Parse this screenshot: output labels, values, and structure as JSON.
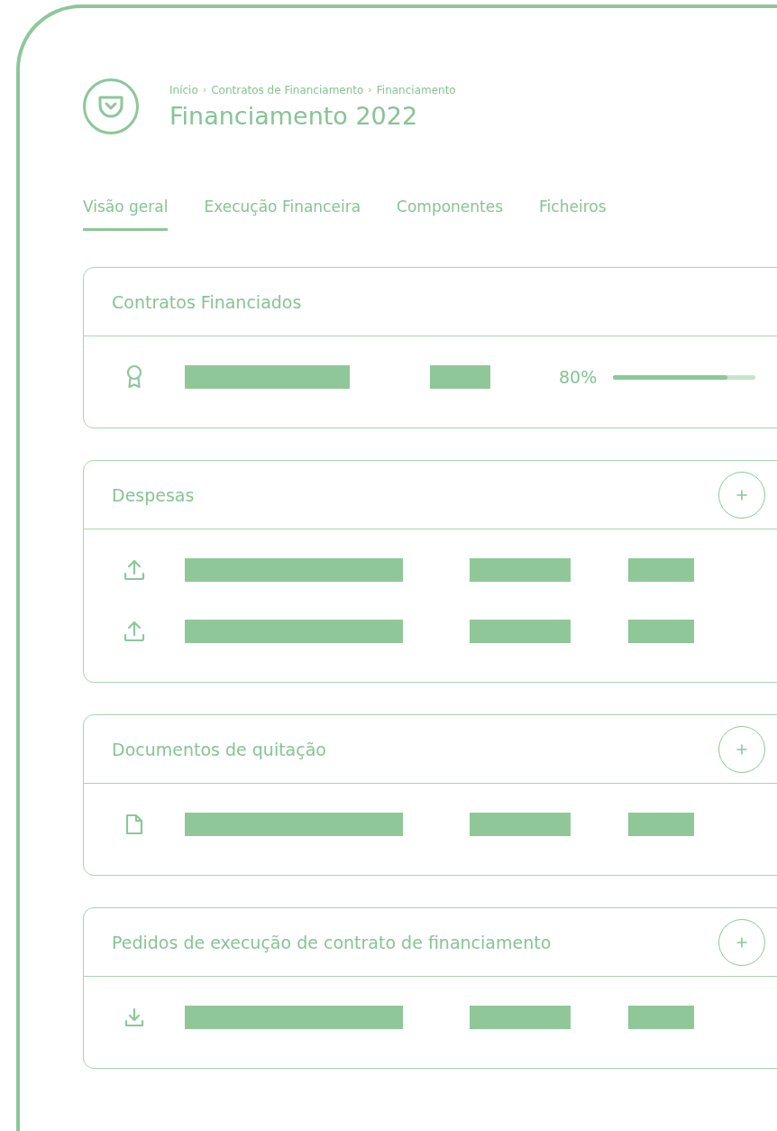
{
  "breadcrumb": {
    "separator": "›",
    "items": [
      "Início",
      "Contratos de Financiamento",
      "Financiamento"
    ]
  },
  "title": "Financiamento 2022",
  "tabs": [
    {
      "label": "Visão geral",
      "selected": true
    },
    {
      "label": "Execução Financeira",
      "selected": false
    },
    {
      "label": "Componentes",
      "selected": false
    },
    {
      "label": "Ficheiros",
      "selected": false
    }
  ],
  "sections": [
    {
      "title": "Contratos Financiados",
      "add_button": false,
      "rows": [
        {
          "kind": "award",
          "progress": {
            "reading": "80%",
            "level": 0.8
          }
        }
      ]
    },
    {
      "title": "Despesas",
      "add_button": true,
      "rows": [
        {
          "kind": "upload"
        },
        {
          "kind": "upload"
        }
      ]
    },
    {
      "title": "Documentos de quitação",
      "add_button": true,
      "rows": [
        {
          "kind": "file"
        }
      ]
    },
    {
      "title": "Pedidos de execução de contrato de financiamento",
      "add_button": true,
      "rows": [
        {
          "kind": "download"
        }
      ]
    }
  ]
}
